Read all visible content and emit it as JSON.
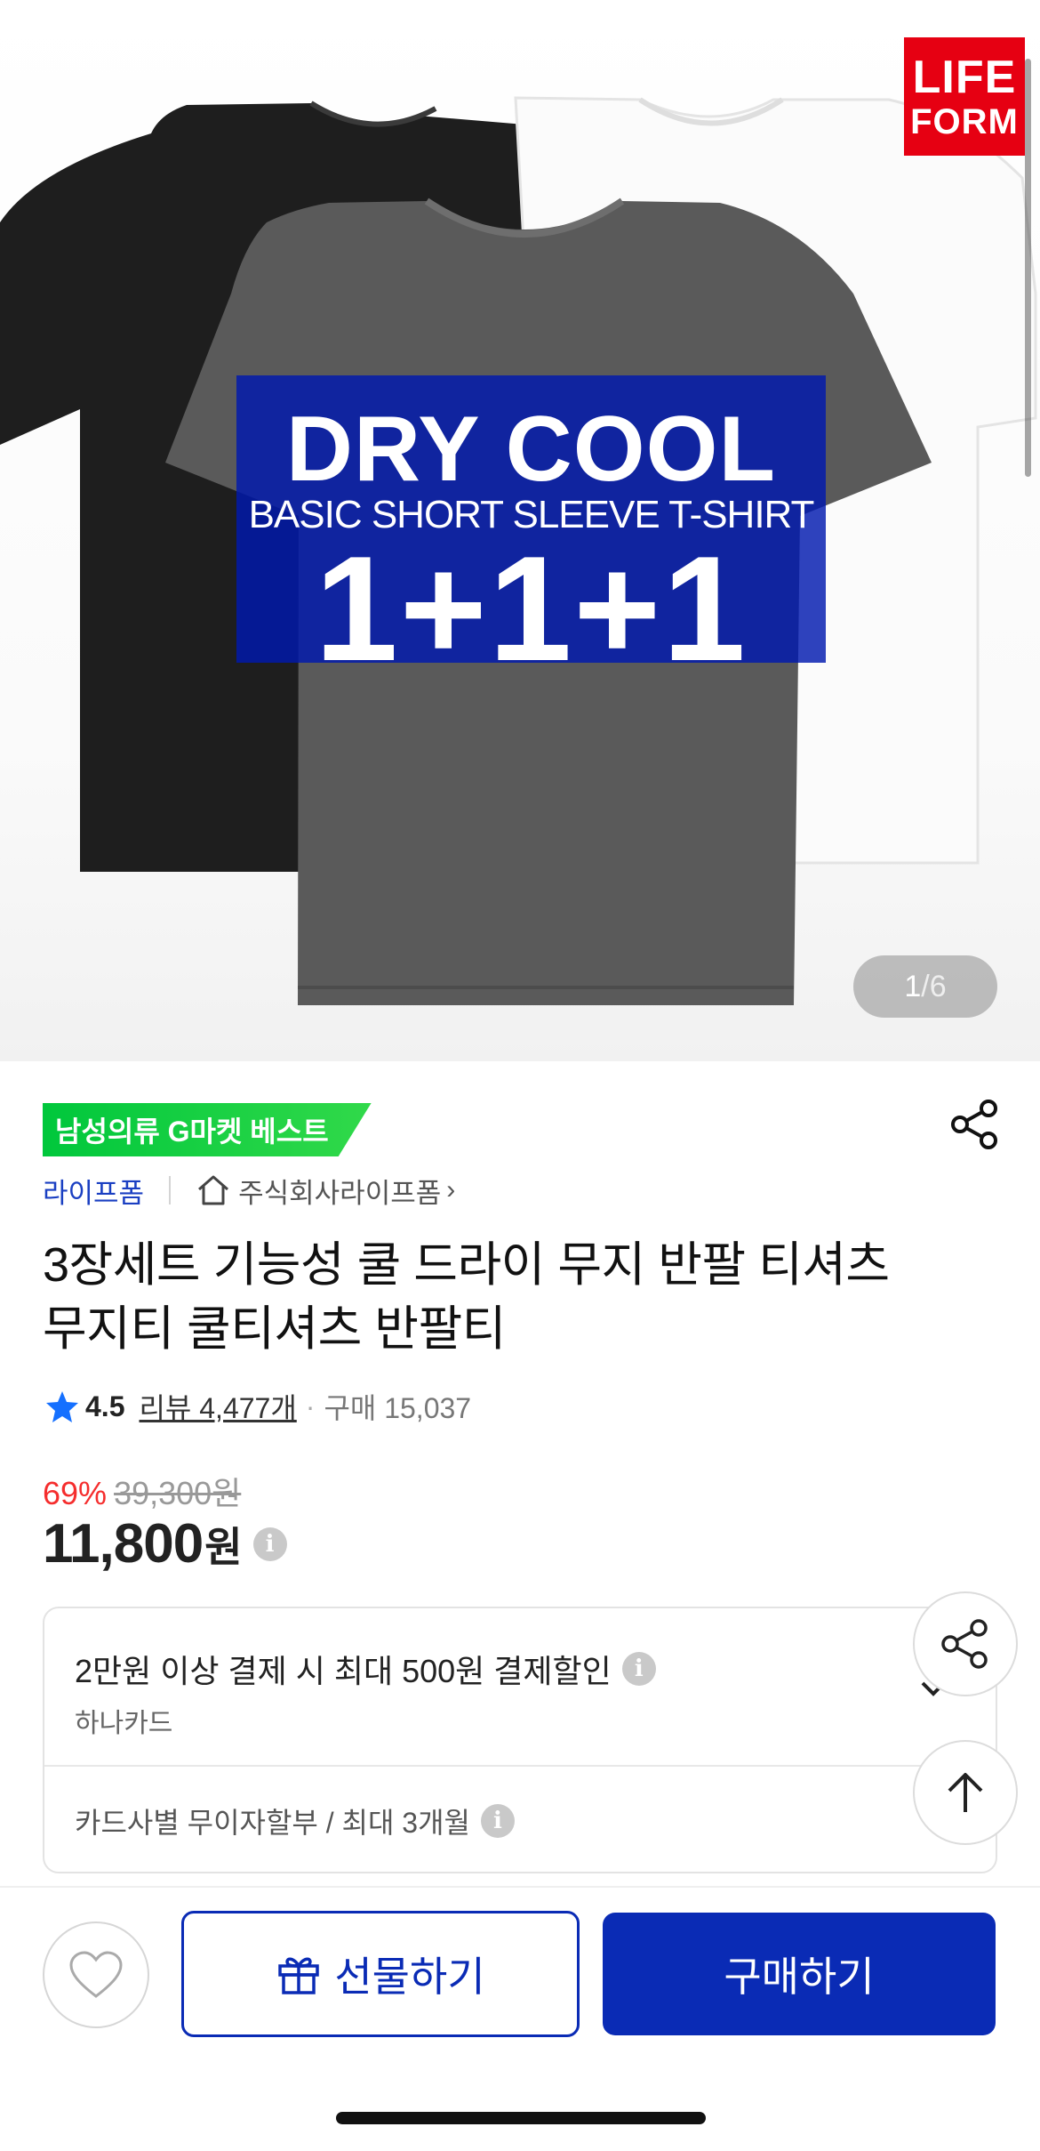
{
  "hero": {
    "brand_logo": {
      "line1": "LIFE",
      "line2": "FORM"
    },
    "banner": {
      "headline": "DRY COOL",
      "subline": "BASIC SHORT SLEEVE T-SHIRT",
      "offer": "1+1+1"
    },
    "pager": {
      "current": "1",
      "total": "/6"
    }
  },
  "product": {
    "badge": "남성의류 G마켓 베스트",
    "seller": "라이프폼",
    "store": "주식회사라이프폼",
    "store_chevron": "›",
    "title": "3장세트 기능성 쿨 드라이 무지 반팔 티셔츠 무지티 쿨티셔츠 반팔티",
    "rating": "4.5",
    "review_text": "리뷰 4,477개",
    "separator": "·",
    "purchase_text": "구매 15,037",
    "discount": "69%",
    "original_price": "39,300원",
    "price": "11,800",
    "price_unit": "원",
    "info_glyph": "i"
  },
  "promo": {
    "line1": "2만원 이상 결제 시 최대 500원 결제할인",
    "line2": "하나카드",
    "line3": "카드사별 무이자할부 / 최대 3개월"
  },
  "actions": {
    "gift_label": "선물하기",
    "buy_label": "구매하기"
  },
  "colors": {
    "brand_blue": "#0a2bb5",
    "discount_red": "#f52d2d",
    "badge_green": "#00c73c",
    "logo_red": "#e60012"
  },
  "icons": [
    "share-icon",
    "home-icon",
    "star-icon",
    "info-icon",
    "chevron-down-icon",
    "arrow-up-icon",
    "heart-icon",
    "gift-icon"
  ]
}
